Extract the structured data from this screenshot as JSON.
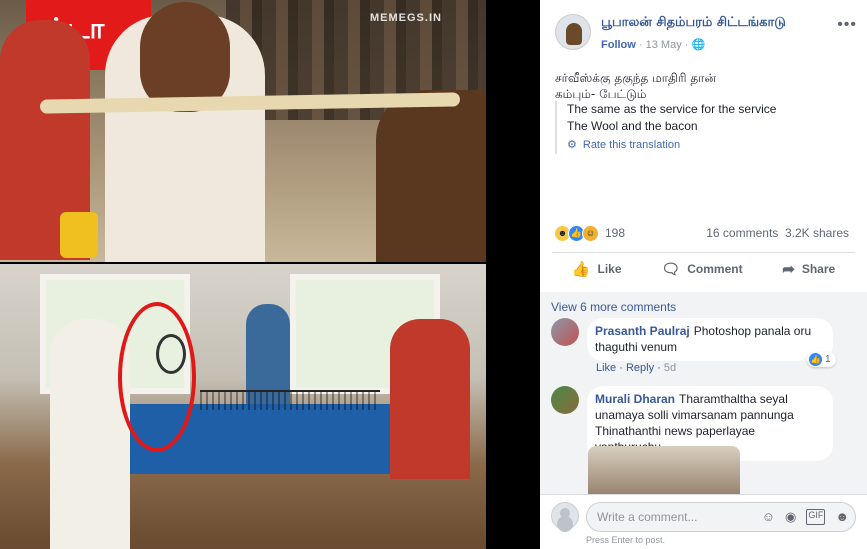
{
  "image": {
    "poster_text": "ட்டா",
    "watermark": "MEMEGS.IN"
  },
  "post": {
    "page_name": "பூபாலன் சிதம்பரம் சிட்டங்காடு",
    "follow_label": "Follow",
    "date": "13 May",
    "text_line1": "சர்வீஸ்க்கு தகுந்த மாதிரி தான்",
    "text_line2": "கம்பும்- பேட்டும்",
    "translation_line1": "The same as the service for the service",
    "translation_line2": "The Wool and the bacon",
    "rate_label": "Rate this translation",
    "reaction_count": "198",
    "comments_count": "16 comments",
    "shares_count": "3.2K shares",
    "like_label": "Like",
    "comment_label": "Comment",
    "share_label": "Share"
  },
  "comments": {
    "view_more": "View 6 more comments",
    "items": [
      {
        "author": "Prasanth Paulraj",
        "text": "Photoshop panala oru thaguthi venum",
        "like": "Like",
        "reply": "Reply",
        "time": "5d",
        "reactions": "1"
      },
      {
        "author": "Murali Dharan",
        "text_line1": "Tharamthaltha seyal",
        "text_line2": "unamaya solli vimarsanam pannunga",
        "text_line3": "Thinathanthi news paperlayae vanthuruchu"
      }
    ]
  },
  "composer": {
    "placeholder": "Write a comment...",
    "hint": "Press Enter to post."
  },
  "icons": [
    "more-icon",
    "globe-icon",
    "gear-icon",
    "like-icon",
    "comment-icon",
    "share-icon",
    "emoji-icon",
    "camera-icon",
    "gif-icon",
    "sticker-icon"
  ],
  "colors": {
    "link": "#365899",
    "like_blue": "#2d88ff",
    "muted": "#606770",
    "background": "#f2f3f5"
  }
}
